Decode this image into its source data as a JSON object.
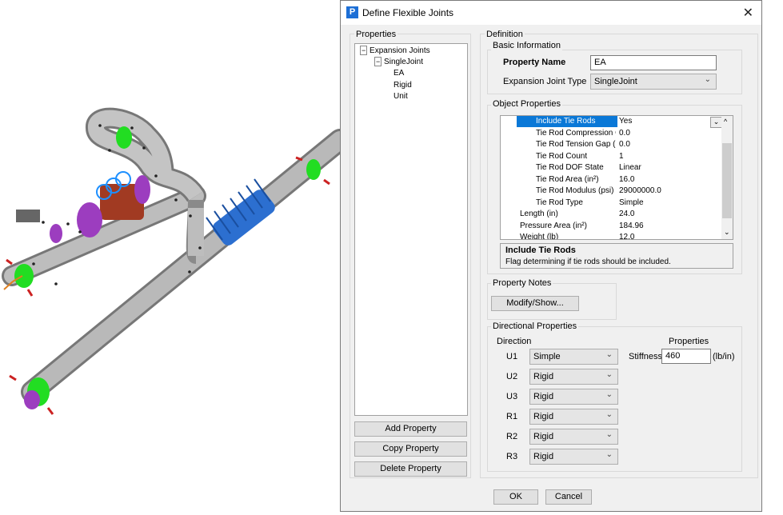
{
  "dialog": {
    "title": "Define Flexible Joints",
    "app_icon_letter": "P",
    "close_glyph": "✕"
  },
  "properties_panel": {
    "label": "Properties",
    "tree": {
      "root": "Expansion Joints",
      "child": "SingleJoint",
      "leaves": [
        "EA",
        "Rigid",
        "Unit"
      ]
    },
    "buttons": {
      "add": "Add Property",
      "copy": "Copy Property",
      "delete": "Delete Property"
    }
  },
  "definition": {
    "label": "Definition",
    "basic_info": {
      "label": "Basic Information",
      "property_name_label": "Property Name",
      "property_name_value": "EA",
      "joint_type_label": "Expansion Joint Type",
      "joint_type_value": "SingleJoint"
    },
    "object_properties": {
      "label": "Object Properties",
      "rows": [
        {
          "name": "Include Tie Rods",
          "value": "Yes"
        },
        {
          "name": "Tie Rod Compression Ga",
          "value": "0.0"
        },
        {
          "name": "Tie Rod Tension Gap (ir",
          "value": "0.0"
        },
        {
          "name": "Tie Rod Count",
          "value": "1"
        },
        {
          "name": "Tie Rod DOF State",
          "value": "Linear"
        },
        {
          "name": "Tie Rod Area (in²)",
          "value": "16.0"
        },
        {
          "name": "Tie Rod Modulus (psi)",
          "value": "29000000.0"
        },
        {
          "name": "Tie Rod Type",
          "value": "Simple"
        },
        {
          "name": "Length (in)",
          "value": "24.0"
        },
        {
          "name": "Pressure Area (in²)",
          "value": "184.96"
        },
        {
          "name": "Weight (lb)",
          "value": "12.0"
        }
      ],
      "desc_title": "Include Tie Rods",
      "desc_text": "Flag determining if tie rods should be included."
    },
    "notes": {
      "label": "Property Notes",
      "button": "Modify/Show..."
    },
    "directional": {
      "label": "Directional Properties",
      "direction_header": "Direction",
      "properties_header": "Properties",
      "rows": [
        {
          "dir": "U1",
          "value": "Simple"
        },
        {
          "dir": "U2",
          "value": "Rigid"
        },
        {
          "dir": "U3",
          "value": "Rigid"
        },
        {
          "dir": "R1",
          "value": "Rigid"
        },
        {
          "dir": "R2",
          "value": "Rigid"
        },
        {
          "dir": "R3",
          "value": "Rigid"
        }
      ],
      "stiffness_label": "Stiffness",
      "stiffness_value": "460",
      "stiffness_unit": "(lb/in)"
    }
  },
  "footer": {
    "ok": "OK",
    "cancel": "Cancel"
  },
  "colors": {
    "pipe": "#b8b8b8",
    "flange": "#22dd22",
    "bellows": "#2c6fd0",
    "valve_body": "#a13a22",
    "purple": "#9c3dbf",
    "selection": "#0a78d7"
  }
}
